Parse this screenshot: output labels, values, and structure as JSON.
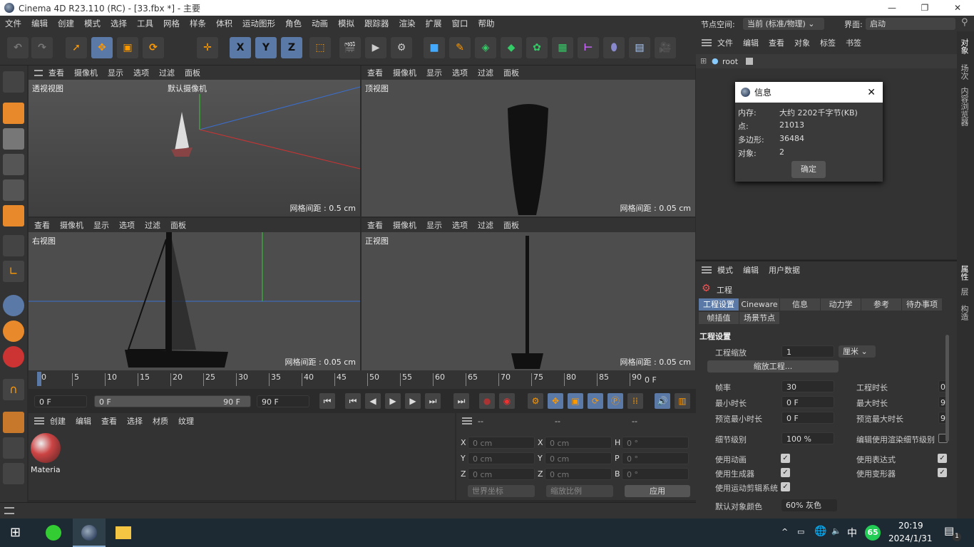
{
  "window": {
    "title": "Cinema 4D R23.110 (RC) - [33.fbx *] - 主要"
  },
  "menu": [
    "文件",
    "编辑",
    "创建",
    "模式",
    "选择",
    "工具",
    "网格",
    "样条",
    "体积",
    "运动图形",
    "角色",
    "动画",
    "模拟",
    "跟踪器",
    "渲染",
    "扩展",
    "窗口",
    "帮助"
  ],
  "node_space": {
    "label": "节点空间:",
    "value": "当前 (标准/物理)"
  },
  "layout": {
    "label": "界面:",
    "value": "启动"
  },
  "toolbar": {
    "axis_buttons": [
      "X",
      "Y",
      "Z"
    ]
  },
  "viewport_menu": [
    "查看",
    "摄像机",
    "显示",
    "选项",
    "过滤",
    "面板"
  ],
  "viewports": [
    {
      "name": "透视视图",
      "camera": "默认摄像机",
      "grid": "网格间距 : 0.5 cm"
    },
    {
      "name": "顶视图",
      "grid": "网格间距 : 0.05 cm"
    },
    {
      "name": "右视图",
      "grid": "网格间距 : 0.05 cm"
    },
    {
      "name": "正视图",
      "grid": "网格间距 : 0.05 cm"
    }
  ],
  "timeline": {
    "ticks": [
      "0",
      "5",
      "10",
      "15",
      "20",
      "25",
      "30",
      "35",
      "40",
      "45",
      "50",
      "55",
      "60",
      "65",
      "70",
      "75",
      "80",
      "85",
      "90"
    ],
    "end_label": "0 F",
    "current": "0 F",
    "range_start": "0 F",
    "range_end": "90 F",
    "max": "90 F"
  },
  "material_panel": {
    "menu": [
      "创建",
      "编辑",
      "查看",
      "选择",
      "材质",
      "纹理"
    ],
    "materials": [
      {
        "name": "Materia"
      }
    ]
  },
  "coords": {
    "headers": [
      "--",
      "--",
      "--"
    ],
    "rows": [
      [
        "X",
        "0 cm",
        "X",
        "0 cm",
        "H",
        "0 °"
      ],
      [
        "Y",
        "0 cm",
        "Y",
        "0 cm",
        "P",
        "0 °"
      ],
      [
        "Z",
        "0 cm",
        "Z",
        "0 cm",
        "B",
        "0 °"
      ]
    ],
    "mode": "世界坐标",
    "scale": "缩放比例",
    "apply": "应用"
  },
  "object_manager": {
    "menu": [
      "文件",
      "编辑",
      "查看",
      "对象",
      "标签",
      "书签"
    ],
    "objects": [
      {
        "name": "root"
      }
    ]
  },
  "info_dialog": {
    "title": "信息",
    "rows": [
      {
        "k": "内存:",
        "v": "大约 2202千字节(KB)"
      },
      {
        "k": "点:",
        "v": "21013"
      },
      {
        "k": "多边形:",
        "v": "36484"
      },
      {
        "k": "对象:",
        "v": "2"
      }
    ],
    "ok": "确定"
  },
  "attributes": {
    "menu": [
      "模式",
      "编辑",
      "用户数据"
    ],
    "object": "工程",
    "tabs": [
      "工程设置",
      "Cineware",
      "信息",
      "动力学",
      "参考",
      "待办事项",
      "帧插值",
      "场景节点"
    ],
    "section": "工程设置",
    "scale": {
      "label": "工程缩放",
      "value": "1",
      "unit": "厘米"
    },
    "scale_button": "缩放工程...",
    "fps": {
      "label": "帧率",
      "value": "30"
    },
    "min_time": {
      "label": "最小时长",
      "value": "0 F"
    },
    "preview_min": {
      "label": "预览最小时长",
      "value": "0 F"
    },
    "project_time": {
      "label": "工程时长",
      "value": "0"
    },
    "max_time": {
      "label": "最大时长",
      "value": "9"
    },
    "preview_max": {
      "label": "预览最大时长",
      "value": "9"
    },
    "lod": {
      "label": "细节级别",
      "value": "100 %"
    },
    "render_lod": {
      "label": "编辑使用渲染细节级别",
      "checked": false
    },
    "checks": [
      {
        "label": "使用动画",
        "checked": true
      },
      {
        "label": "使用生成器",
        "checked": true
      },
      {
        "label": "使用运动剪辑系统",
        "checked": true
      },
      {
        "label": "使用表达式",
        "checked": true
      },
      {
        "label": "使用变形器",
        "checked": true
      }
    ],
    "default_color": {
      "label": "默认对象颜色",
      "value": "60% 灰色"
    }
  },
  "side_tabs": [
    "对象",
    "场次",
    "内容浏览器",
    "属性",
    "层",
    "构造"
  ],
  "taskbar": {
    "time": "20:19",
    "date": "2024/1/31",
    "ime": "中",
    "badge": "65",
    "notifications": "1"
  },
  "colors": {
    "accent": "#5a79a6",
    "bg": "#333333",
    "viewport": "#4d4d4d"
  }
}
